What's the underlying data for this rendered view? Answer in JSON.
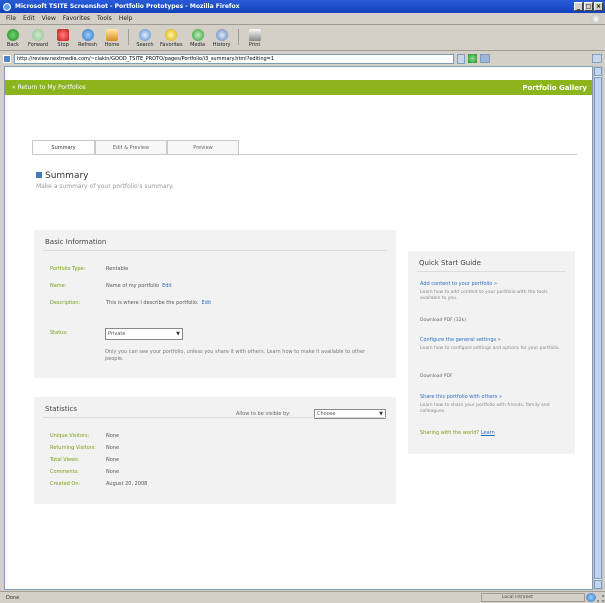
{
  "window": {
    "title": "Microsoft TSITE Screenshot - Portfolio Prototypes - Mozilla Firefox",
    "minimize": "_",
    "maximize": "□",
    "close": "×"
  },
  "menubar": [
    "File",
    "Edit",
    "View",
    "Favorites",
    "Tools",
    "Help"
  ],
  "toolbar": {
    "back": "Back",
    "forward": "Forward",
    "stop": "Stop",
    "refresh": "Refresh",
    "home": "Home",
    "search": "Search",
    "favorites": "Favorites",
    "media": "Media",
    "history": "History",
    "print": "Print"
  },
  "address": {
    "url": "http://review.nextmedia.com/~clakin/GOOD_TSITE_PROTO/pages/Portfolio/i3_summary.html?editing=1",
    "links": "Links"
  },
  "topbar": {
    "return_link": "« Return to My Portfolios",
    "brand": "Portfolio Gallery"
  },
  "tabs": [
    "Summary",
    "Edit & Preview",
    "Preview"
  ],
  "section": {
    "title": "Summary",
    "subtitle": "Make a summary of your portfolio's summary."
  },
  "basic": {
    "title": "Basic Information",
    "fields": [
      {
        "k": "Portfolio Type:",
        "v": "Rentable",
        "edit": ""
      },
      {
        "k": "Name:",
        "v": "Name of my portfolio",
        "edit": "Edit"
      },
      {
        "k": "Description:",
        "v": "This is where I describe the portfolio.",
        "edit": "Edit"
      }
    ],
    "status_label": "Status:",
    "status_value": "Private",
    "status_note": "Only you can see your portfolio, unless you share it with others. Learn how to make it available to other people."
  },
  "stats": {
    "title": "Statistics",
    "visible_label": "Allow to be visible by:",
    "visible_value": "Choose",
    "rows": [
      {
        "k": "Unique Visitors:",
        "v": "None"
      },
      {
        "k": "Returning Visitors:",
        "v": "None"
      },
      {
        "k": "Total Views:",
        "v": "None"
      },
      {
        "k": "Comments:",
        "v": "None"
      },
      {
        "k": "Created On:",
        "v": "August 20, 2008"
      }
    ]
  },
  "quick": {
    "title": "Quick Start Guide",
    "items": [
      {
        "link": "Add content to your portfolio »",
        "desc": "Learn how to add content to your portfolio with the tools available to you.",
        "dl": "Download PDF (32k)"
      },
      {
        "link": "Configure the general settings »",
        "desc": "Learn how to configure settings and options for your portfolio.",
        "dl": "Download PDF"
      },
      {
        "link": "Share this portfolio with others »",
        "desc": "Learn how to share your portfolio with friends, family and colleagues."
      }
    ],
    "share_text": "Sharing with the world?",
    "learn": "Learn"
  },
  "statusbar": {
    "done": "Done",
    "zone": "Local intranet"
  }
}
